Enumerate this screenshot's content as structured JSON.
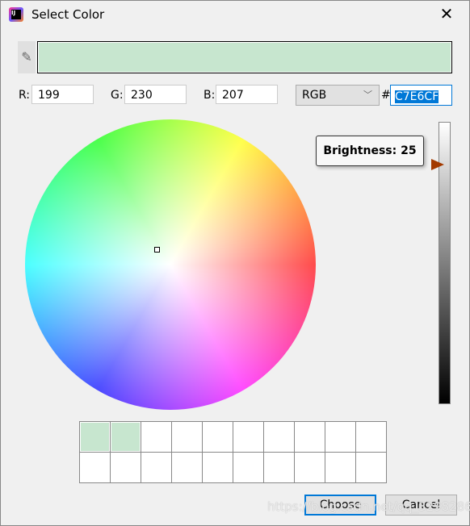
{
  "window": {
    "title": "Select Color",
    "close_icon": "close-icon"
  },
  "preview": {
    "color": "#c7e6cf",
    "picker_icon": "eyedropper-icon"
  },
  "fields": {
    "r_label": "R:",
    "r": "199",
    "g_label": "G:",
    "g": "230",
    "b_label": "B:",
    "b": "207",
    "mode": "RGB",
    "hash": "#",
    "hex": "C7E6CF"
  },
  "brightness": {
    "tooltip": "Brightness: 25",
    "value": 25
  },
  "recent_colors": [
    "#c7e6cf",
    "#c7e6cf",
    "",
    "",
    "",
    "",
    "",
    "",
    "",
    "",
    "",
    "",
    "",
    "",
    "",
    "",
    "",
    "",
    "",
    ""
  ],
  "buttons": {
    "choose": "Choose",
    "cancel": "Cancel"
  },
  "watermark": "https://blog.csdn.net/qq_32982864"
}
